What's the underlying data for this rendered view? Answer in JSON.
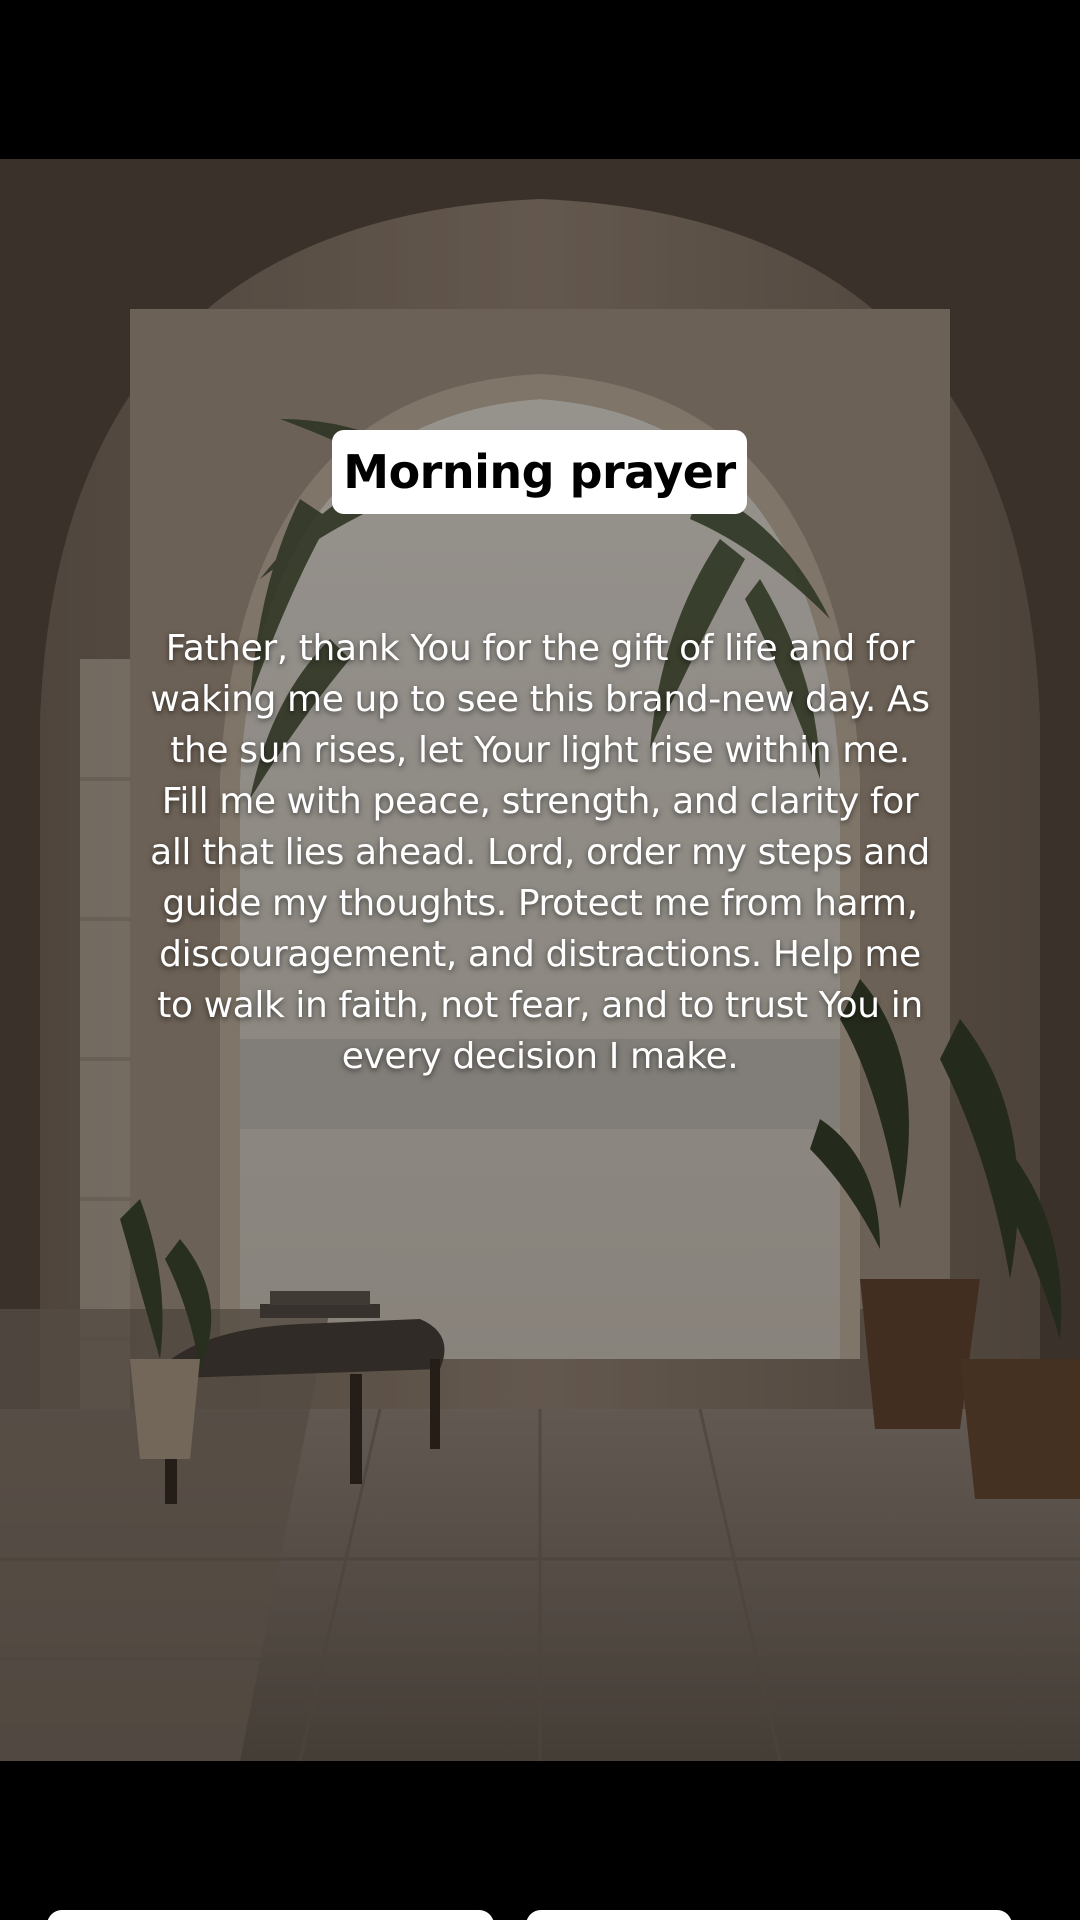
{
  "post": {
    "title": "Morning prayer",
    "body": "Father, thank You for the gift of life and for waking me up to see this brand-new day. As the sun rises, let Your light rise within me. Fill me with peace, strength, and clarity for all that lies ahead. Lord, order my steps and guide my thoughts. Protect me from harm, discouragement, and distractions. Help me to walk in faith, not fear, and to trust You in every decision I make."
  },
  "colors": {
    "background": "#000000",
    "pill": "#ffffff",
    "title_text": "#000000",
    "body_text": "#ffffff"
  }
}
